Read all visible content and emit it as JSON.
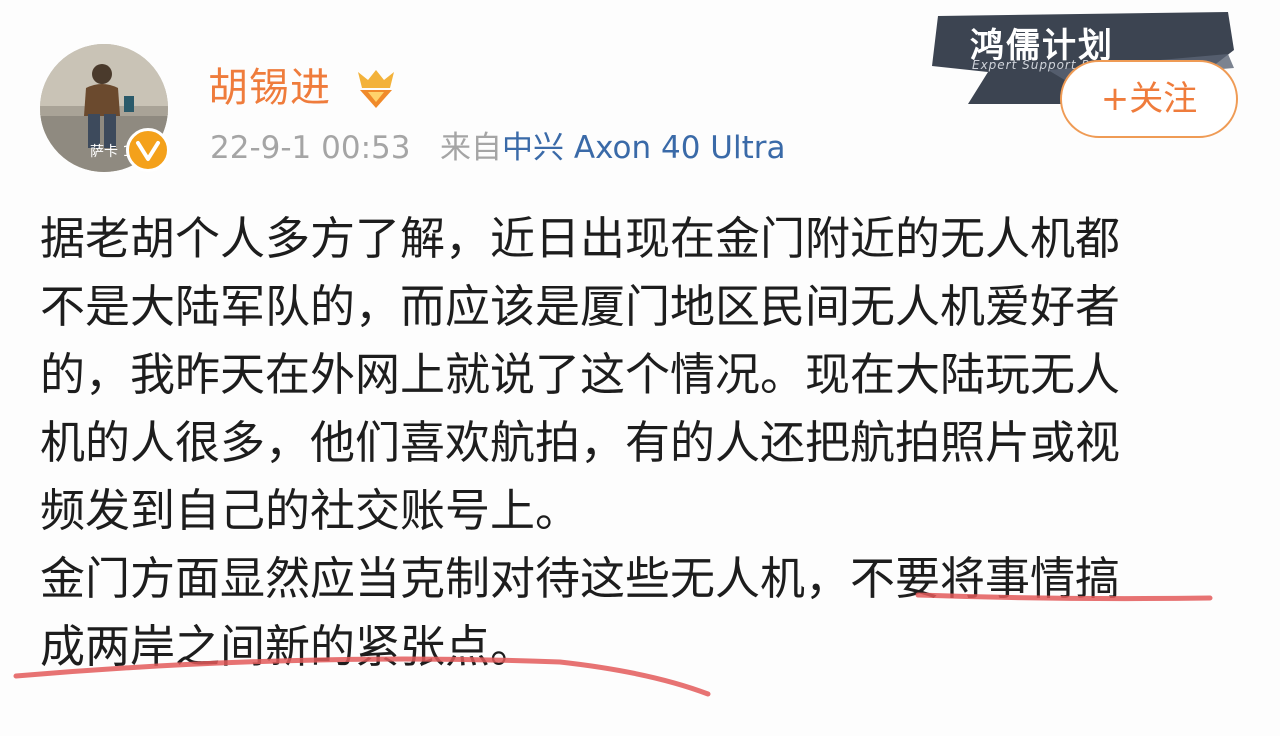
{
  "user": {
    "name": "胡锡进",
    "avatar_caption": "萨卡 19"
  },
  "post_meta": {
    "timestamp": "22-9-1 00:53",
    "source_prefix": "来自",
    "device": "中兴 Axon 40 Ultra"
  },
  "follow_button": {
    "label": "+关注"
  },
  "watermark": {
    "title": "鸿儒计划",
    "subtitle": "Expert Support Pro"
  },
  "post": {
    "lines": [
      "据老胡个人多方了解，近日出现在金门附近的无人机都",
      "不是大陆军队的，而应该是厦门地区民间无人机爱好者",
      "的，我昨天在外网上就说了这个情况。现在大陆玩无人",
      "机的人很多，他们喜欢航拍，有的人还把航拍照片或视",
      "频发到自己的社交账号上。",
      "金门方面显然应当克制对待这些无人机，不要将事情搞",
      "成两岸之间新的紧张点。"
    ]
  },
  "colors": {
    "username": "#ef7c3c",
    "device_link": "#3a6aa8",
    "underline": "#e35a5a",
    "badge": "#f4a11b"
  }
}
